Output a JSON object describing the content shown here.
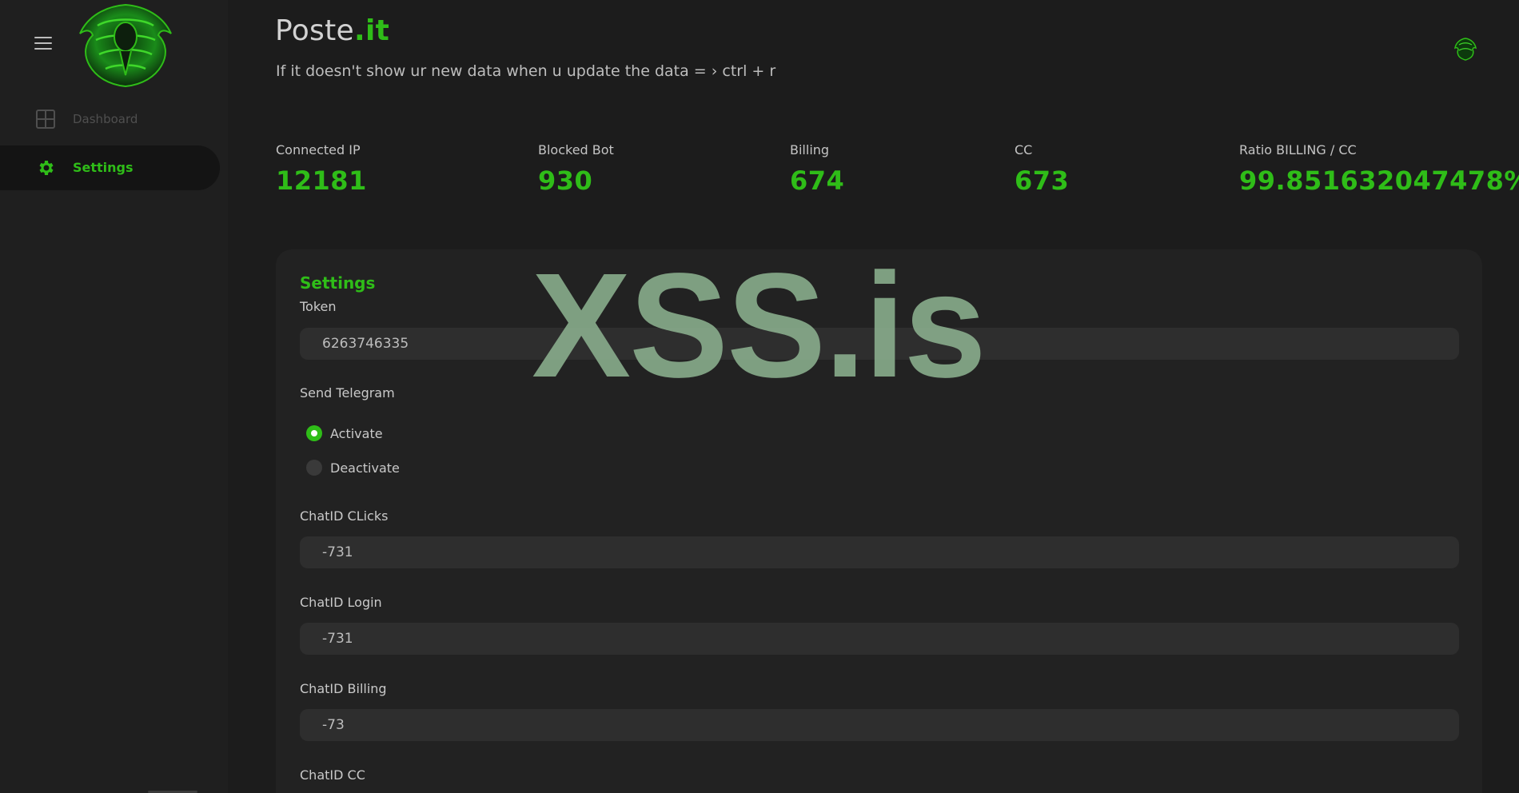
{
  "header": {
    "brand_main": "Poste",
    "brand_accent": ".it",
    "subtitle": "If it doesn't show ur new data when u update the data = › ctrl + r"
  },
  "sidebar": {
    "items": [
      {
        "label": "Dashboard",
        "icon": "grid-icon",
        "active": false
      },
      {
        "label": "Settings",
        "icon": "gear-icon",
        "active": true
      }
    ]
  },
  "stats": [
    {
      "label": "Connected IP",
      "value": "12181"
    },
    {
      "label": "Blocked Bot",
      "value": "930"
    },
    {
      "label": "Billing",
      "value": "674"
    },
    {
      "label": "CC",
      "value": "673"
    },
    {
      "label": "Ratio BILLING / CC",
      "value": "99.851632047478%"
    }
  ],
  "settings": {
    "title": "Settings",
    "token_label": "Token",
    "token_value": "6263746335",
    "send_telegram_label": "Send Telegram",
    "radio_activate": "Activate",
    "radio_deactivate": "Deactivate",
    "selected": "Activate",
    "chatid_clicks_label": "ChatID CLicks",
    "chatid_clicks_value": "-731",
    "chatid_login_label": "ChatID Login",
    "chatid_login_value": "-731",
    "chatid_billing_label": "ChatID Billing",
    "chatid_billing_value": "-73",
    "chatid_cc_label": "ChatID CC"
  },
  "watermark": "XSS.is",
  "colors": {
    "accent": "#2fbd18",
    "background": "#1c1c1c",
    "card": "#222222",
    "input": "#2e2e2e"
  }
}
